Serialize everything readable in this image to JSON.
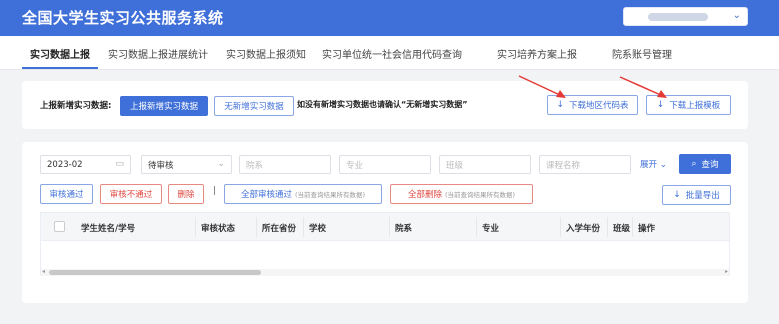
{
  "header": {
    "title": "全国大学生实习公共服务系统",
    "user_menu_caret": "⌄"
  },
  "nav": {
    "tabs": [
      {
        "label": "实习数据上报",
        "active": true
      },
      {
        "label": "实习数据上报进展统计"
      },
      {
        "label": "实习数据上报须知"
      },
      {
        "label": "实习单位统一社会信用代码查询"
      },
      {
        "label": "实习培养方案上报"
      },
      {
        "label": "院系账号管理"
      }
    ]
  },
  "report": {
    "label": "上报新增实习数据:",
    "report_new_button": "上报新增实习数据",
    "no_new_button": "无新增实习数据",
    "confirm_hint": "如没有新增实习数据也请确认“无新增实习数据”",
    "download_region_codes": "下载地区代码表",
    "download_template": "下载上报模板",
    "download_icon": "↓"
  },
  "filters": {
    "date_value": "2023-02",
    "status_value": "待审核",
    "department_placeholder": "院系",
    "major_placeholder": "专业",
    "class_placeholder": "班级",
    "course_placeholder": "课程名称",
    "expand": "展开",
    "expand_icon": "⌄",
    "search_button": "查询",
    "search_icon": "⌕",
    "calendar_icon": "▭",
    "chevron_icon": "⌄"
  },
  "actions": {
    "approve": "审核通过",
    "reject": "审核不通过",
    "delete": "删除",
    "separator": "|",
    "approve_all": "全部审核通过",
    "approve_all_note": "(当前查询结果所有数据)",
    "delete_all": "全部删除",
    "delete_all_note": "(当前查询结果所有数据)",
    "batch_export": "批量导出",
    "export_icon": "↓"
  },
  "table": {
    "columns": [
      "学生姓名/学号",
      "审核状态",
      "所在省份",
      "学校",
      "院系",
      "专业",
      "入学年份",
      "班级",
      "操作"
    ],
    "scroll_left": "◂",
    "scroll_right": "▸"
  },
  "colors": {
    "brand": "#3f6fd8",
    "danger": "#e0453e",
    "annotation": "#e53935"
  }
}
